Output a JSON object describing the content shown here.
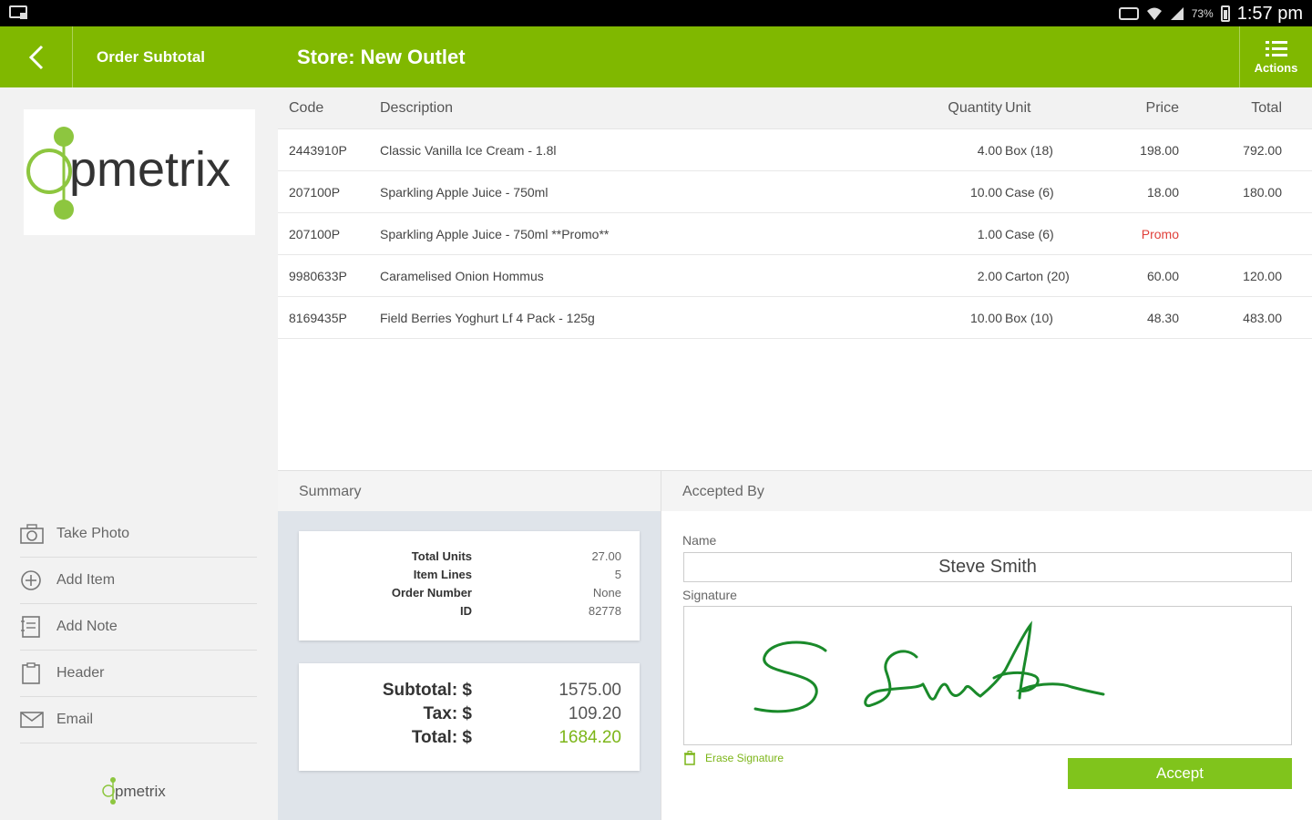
{
  "status_bar": {
    "battery": "73%",
    "time": "1:57 pm"
  },
  "app_bar": {
    "subtitle": "Order Subtotal",
    "title": "Store: New Outlet",
    "actions_label": "Actions"
  },
  "brand": {
    "logo_text": "Opmetrix",
    "accent_color": "#80b800"
  },
  "sidebar": {
    "items": [
      {
        "label": "Take Photo",
        "icon": "camera-icon"
      },
      {
        "label": "Add Item",
        "icon": "plus-circle-icon"
      },
      {
        "label": "Add Note",
        "icon": "note-icon"
      },
      {
        "label": "Header",
        "icon": "clipboard-icon"
      },
      {
        "label": "Email",
        "icon": "envelope-icon"
      }
    ]
  },
  "table": {
    "headers": {
      "code": "Code",
      "description": "Description",
      "quantity": "Quantity",
      "unit": "Unit",
      "price": "Price",
      "total": "Total"
    },
    "rows": [
      {
        "code": "2443910P",
        "description": "Classic Vanilla Ice Cream - 1.8l",
        "quantity": "4.00",
        "unit": "Box (18)",
        "price": "198.00",
        "total": "792.00"
      },
      {
        "code": "207100P",
        "description": "Sparkling Apple Juice - 750ml",
        "quantity": "10.00",
        "unit": "Case (6)",
        "price": "18.00",
        "total": "180.00"
      },
      {
        "code": "207100P",
        "description": "Sparkling Apple Juice - 750ml **Promo**",
        "quantity": "1.00",
        "unit": "Case (6)",
        "price": "Promo",
        "total": ""
      },
      {
        "code": "9980633P",
        "description": "Caramelised Onion Hommus",
        "quantity": "2.00",
        "unit": "Carton (20)",
        "price": "60.00",
        "total": "120.00"
      },
      {
        "code": "8169435P",
        "description": "Field Berries Yoghurt Lf 4 Pack - 125g",
        "quantity": "10.00",
        "unit": "Box (10)",
        "price": "48.30",
        "total": "483.00"
      }
    ]
  },
  "summary": {
    "heading": "Summary",
    "details": [
      {
        "key": "Total Units",
        "value": "27.00"
      },
      {
        "key": "Item Lines",
        "value": "5"
      },
      {
        "key": "Order Number",
        "value": "None"
      },
      {
        "key": "ID",
        "value": "82778"
      }
    ],
    "totals": [
      {
        "key": "Subtotal: $",
        "value": "1575.00"
      },
      {
        "key": "Tax: $",
        "value": "109.20"
      },
      {
        "key": "Total: $",
        "value": "1684.20"
      }
    ]
  },
  "accepted_by": {
    "heading": "Accepted By",
    "name_label": "Name",
    "name_value": "Steve Smith",
    "signature_label": "Signature",
    "erase_label": "Erase Signature",
    "accept_label": "Accept"
  }
}
